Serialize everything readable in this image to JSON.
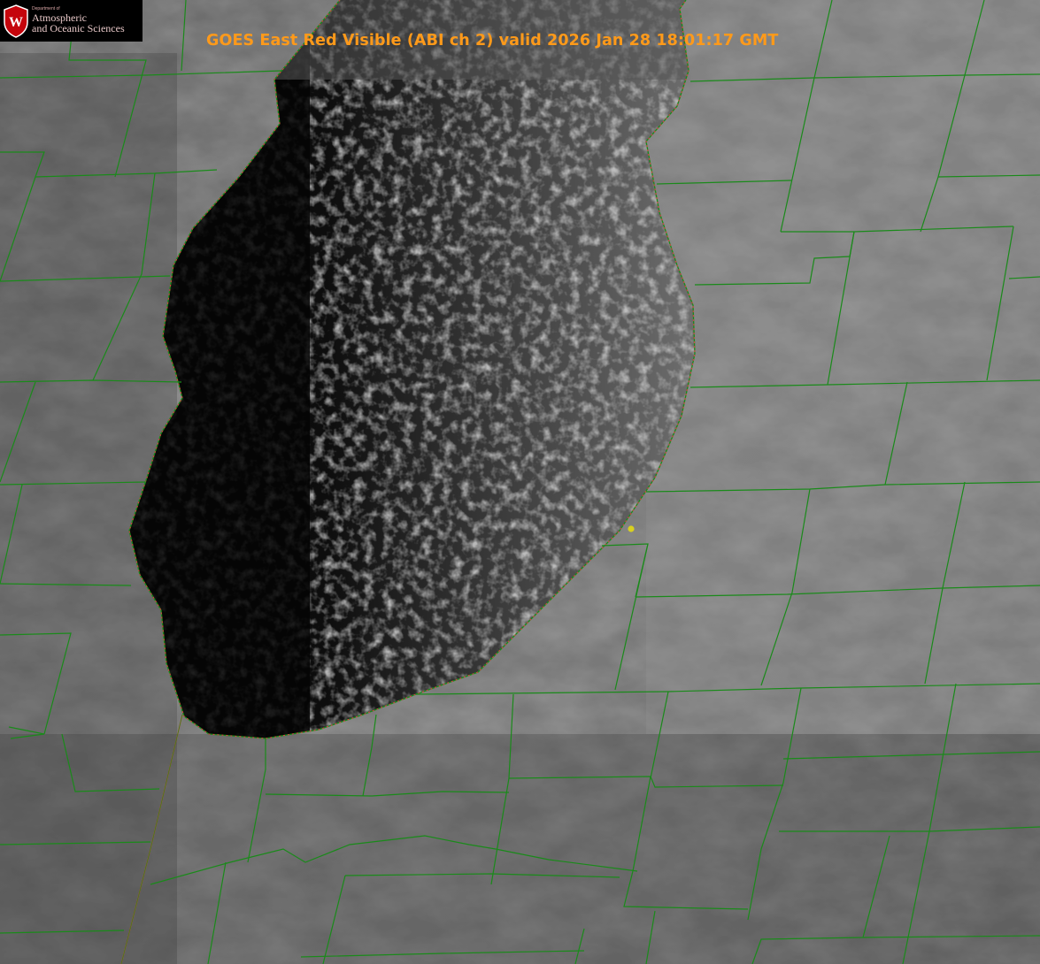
{
  "title": "GOES East Red Visible (ABI ch 2) valid 2026 Jan 28 18:01:17 GMT",
  "logo": {
    "department": "Department of",
    "line1": "Atmospheric",
    "line2": "and Oceanic Sciences",
    "emblem_letter": "W"
  },
  "colors": {
    "title": "#ff9a1a",
    "county_lines": "#1a8a1a",
    "state_line": "#cc4a22",
    "shoreline_dash": "#e04040",
    "marker": "#d8d020",
    "emblem": "#c5050c"
  },
  "map": {
    "feature": "lake",
    "marker_icon": "station-dot-icon"
  }
}
